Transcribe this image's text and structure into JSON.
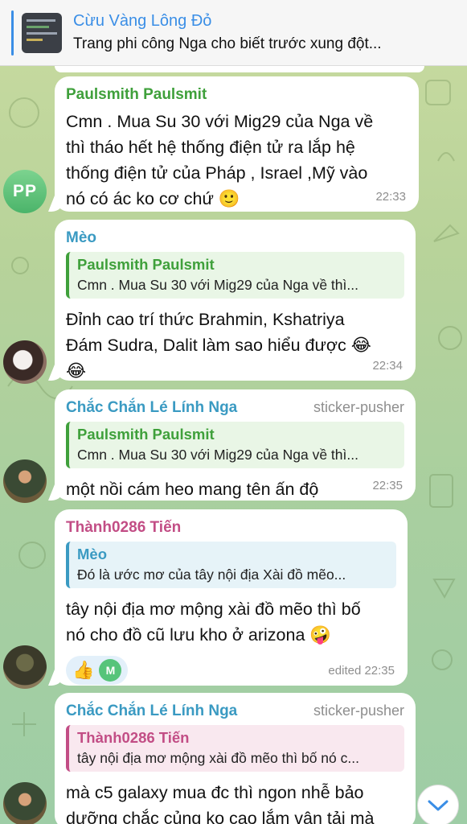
{
  "pinned": {
    "title": "Cừu Vàng Lông Đỏ",
    "text": "Trang phi công Nga cho biết trước xung đột..."
  },
  "messages": [
    {
      "avatar_initials": "PP",
      "sender": "Paulsmith Paulsmit",
      "text_lines": [
        "Cmn . Mua Su 30 với Mig29 của Nga về",
        "thì tháo hết hệ thống điện tử ra lắp hệ",
        "thống điện tử của Pháp , Israel ,Mỹ vào",
        "nó có ác ko cơ chứ 🙂"
      ],
      "time": "22:33"
    },
    {
      "sender": "Mèo",
      "quote": {
        "name": "Paulsmith Paulsmit",
        "text": "Cmn . Mua Su 30 với Mig29 của Nga về thì..."
      },
      "text_lines": [
        "Đỉnh cao trí thức Brahmin, Kshatriya",
        "Đám Sudra, Dalit làm sao hiểu được 😂",
        "😂"
      ],
      "time": "22:34"
    },
    {
      "sender": "Chắc Chắn Lé Lính Nga",
      "tag": "sticker-pusher",
      "quote": {
        "name": "Paulsmith Paulsmit",
        "text": "Cmn . Mua Su 30 với Mig29 của Nga về thì..."
      },
      "text_lines": [
        "một nồi cám heo mang tên ấn độ"
      ],
      "time": "22:35"
    },
    {
      "sender": "Thành0286 Tiến",
      "quote": {
        "name": "Mèo",
        "text": "Đó là ước mơ của tây nội địa Xài đồ mẽo..."
      },
      "text_lines": [
        "tây nội địa mơ mộng xài đồ mẽo thì bố",
        "nó cho đồ cũ lưu kho ở arizona 🤪"
      ],
      "reaction": {
        "emoji": "👍",
        "avatar_initial": "M"
      },
      "time": "edited 22:35"
    },
    {
      "sender": "Chắc Chắn Lé Lính Nga",
      "tag": "sticker-pusher",
      "quote": {
        "name": "Thành0286 Tiến",
        "text": "tây nội địa mơ mộng xài đồ mẽo thì bố nó c..."
      },
      "text_lines": [
        "mà c5 galaxy mua đc thì ngon nhễ bảo",
        "dưỡng chắc củng ko cao lắm vận tải mà"
      ]
    }
  ],
  "colors": {
    "accent": "#3a8ee6",
    "green_name": "#3fa03b",
    "blue_name": "#3a9ac2",
    "pink_name": "#c24d85"
  }
}
